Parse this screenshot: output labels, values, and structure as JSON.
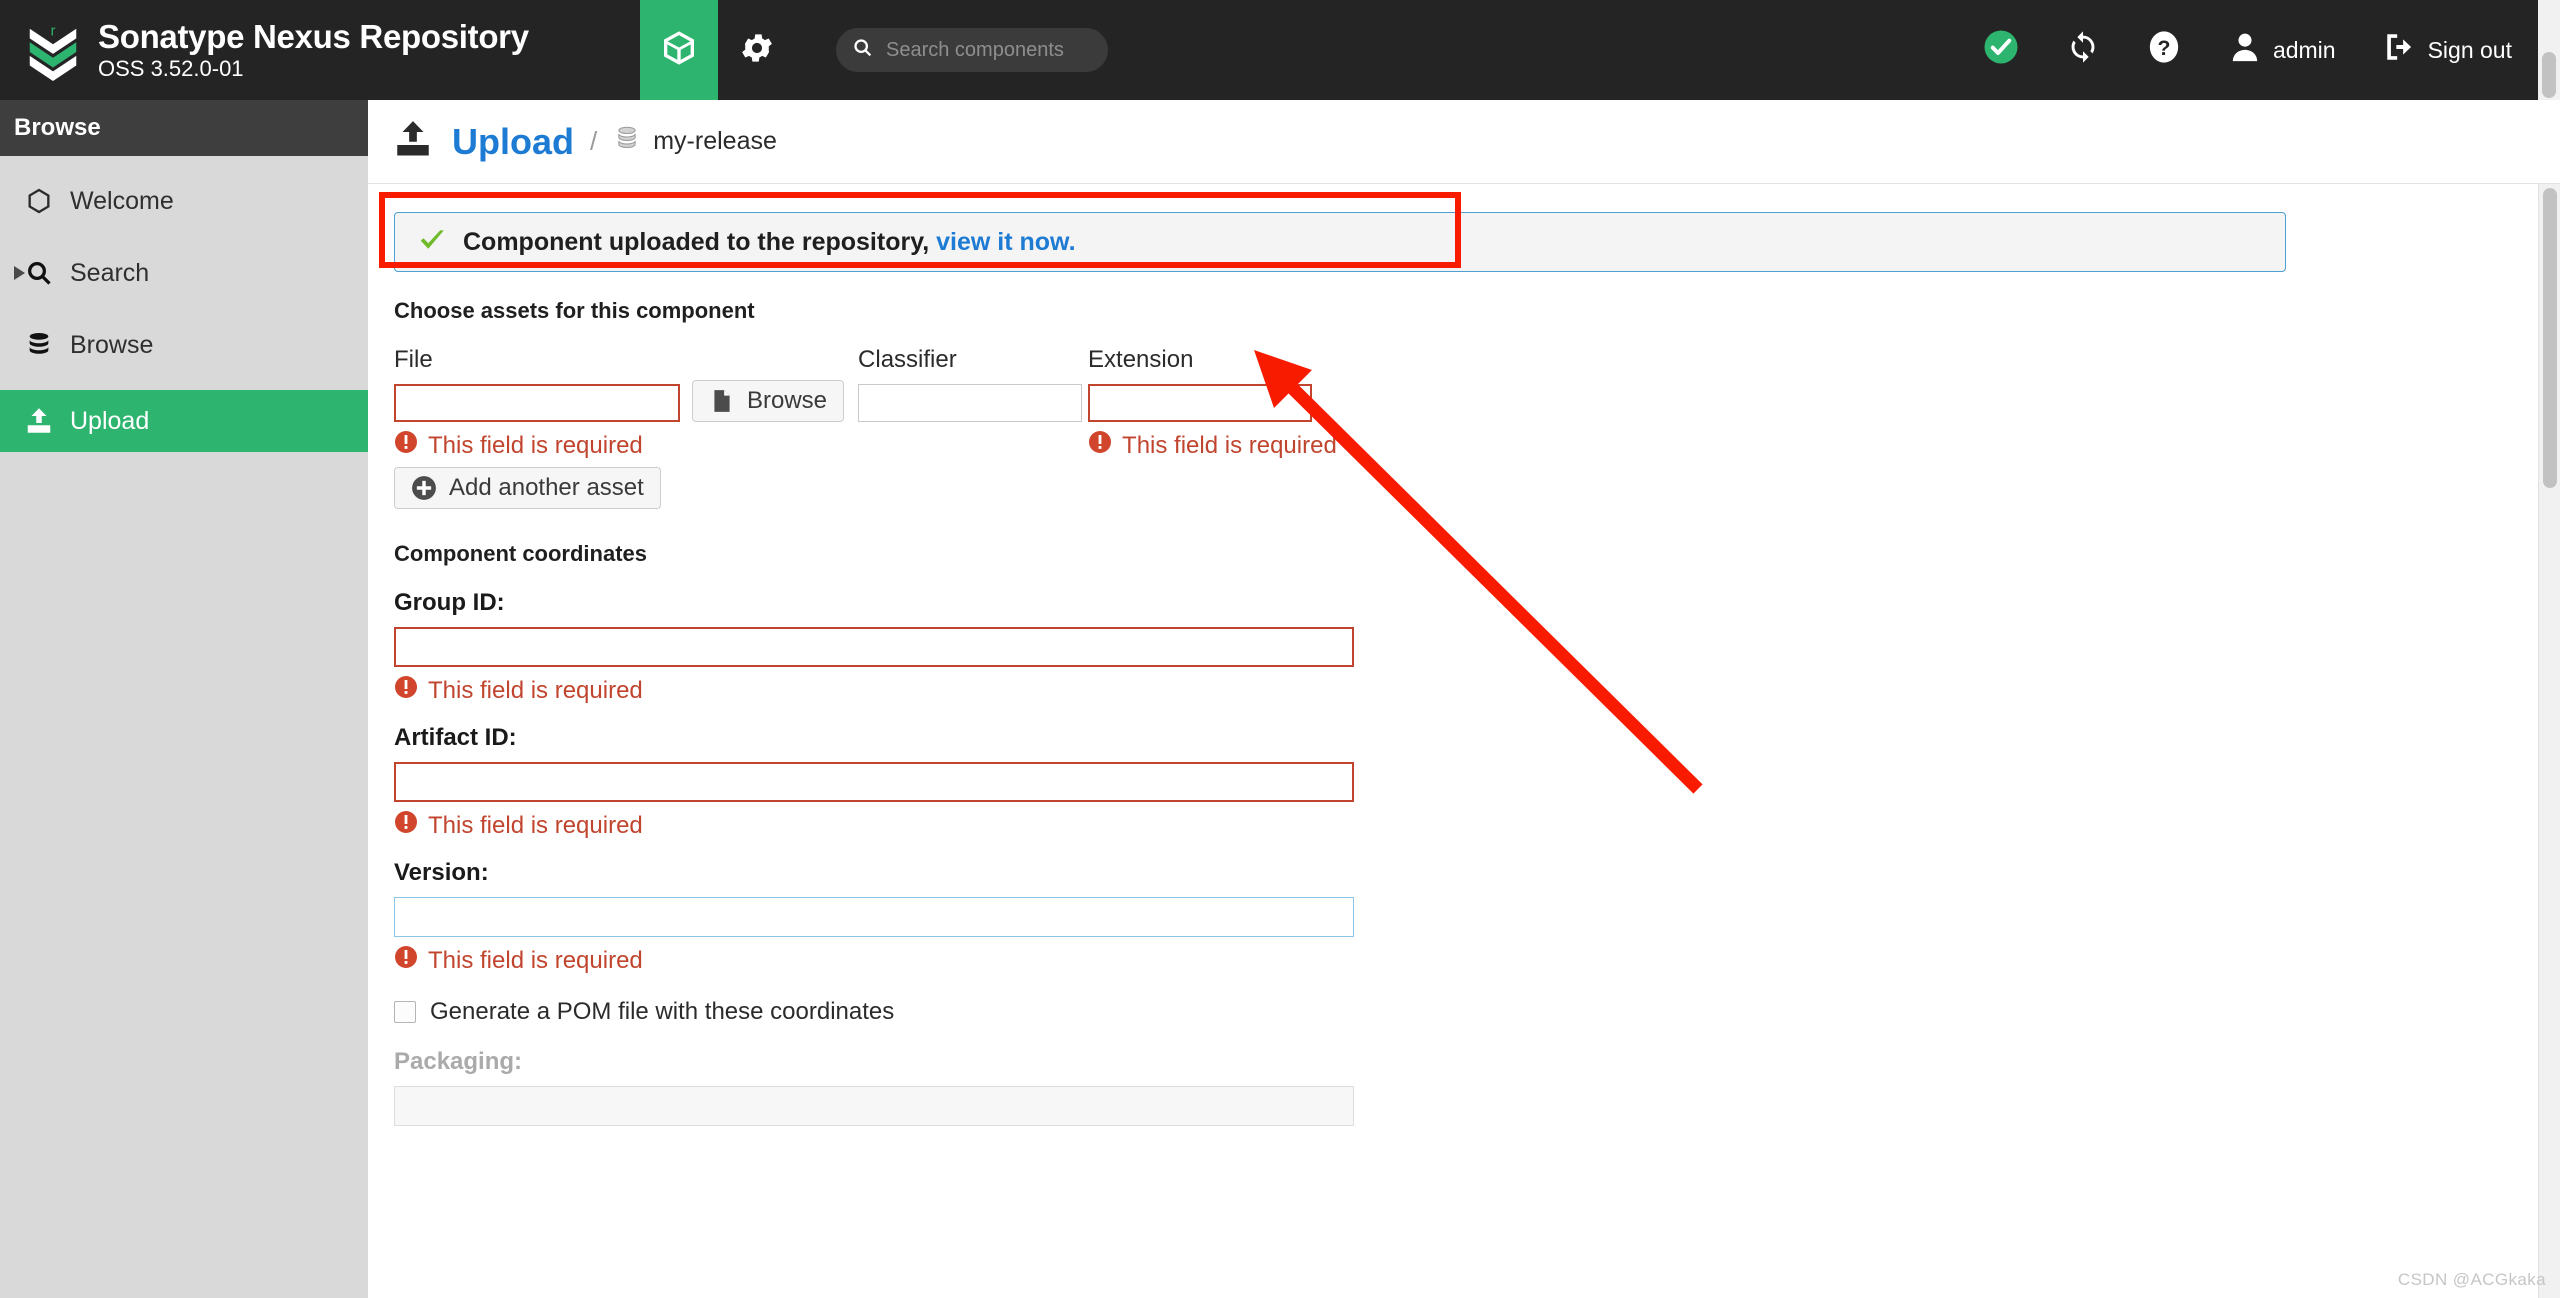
{
  "header": {
    "brand_title": "Sonatype Nexus Repository",
    "brand_subtitle": "OSS 3.52.0-01",
    "logo_icon": "nexus-chevron-logo",
    "cube_icon": "cube-icon",
    "gear_icon": "gear-icon",
    "search": {
      "placeholder": "Search components",
      "value": "",
      "icon": "search-icon"
    },
    "status_icon": "green-check-circle-icon",
    "refresh_icon": "refresh-sync-icon",
    "help_icon": "help-question-icon",
    "user_icon": "user-avatar-icon",
    "user_label": "admin",
    "signout_icon": "sign-out-icon",
    "signout_label": "Sign out",
    "accent_green": "#2db56f",
    "bar_color": "#242424"
  },
  "sidebar": {
    "title": "Browse",
    "items": [
      {
        "label": "Welcome",
        "icon": "hexagon-icon",
        "active": false,
        "expandable": false
      },
      {
        "label": "Search",
        "icon": "search-icon",
        "active": false,
        "expandable": true
      },
      {
        "label": "Browse",
        "icon": "database-icon",
        "active": false,
        "expandable": false
      },
      {
        "label": "Upload",
        "icon": "upload-icon",
        "active": true,
        "expandable": false
      }
    ]
  },
  "breadcrumb": {
    "icon": "upload-icon",
    "title": "Upload",
    "separator": "/",
    "repo_icon": "database-icon",
    "repo_name": "my-release"
  },
  "alert": {
    "icon": "green-check-icon",
    "message": "Component uploaded to the repository,",
    "link_text": "view it now.",
    "border_color": "#4f9fd4",
    "background": "#f4f4f4"
  },
  "assets": {
    "section_title": "Choose assets for this component",
    "file_label": "File",
    "file_value": "",
    "file_error": "This field is required",
    "browse_label": "Browse",
    "browse_icon": "file-document-icon",
    "classifier_label": "Classifier",
    "classifier_value": "",
    "extension_label": "Extension",
    "extension_value": "",
    "extension_error": "This field is required",
    "add_asset_label": "Add another asset",
    "add_asset_icon": "plus-circle-icon",
    "error_icon": "exclamation-circle-icon"
  },
  "coordinates": {
    "section_title": "Component coordinates",
    "fields": [
      {
        "label": "Group ID:",
        "value": "",
        "error": "This field is required",
        "state": "error"
      },
      {
        "label": "Artifact ID:",
        "value": "",
        "error": "This field is required",
        "state": "error"
      },
      {
        "label": "Version:",
        "value": "",
        "error": "This field is required",
        "state": "focus"
      }
    ],
    "pom_checkbox_label": "Generate a POM file with these coordinates",
    "pom_checkbox_checked": false,
    "packaging_label": "Packaging:",
    "packaging_value": ""
  },
  "annotation": {
    "rect_color": "#f91b00",
    "arrow_color": "#f91b00"
  },
  "watermark": "CSDN @ACGkaka"
}
